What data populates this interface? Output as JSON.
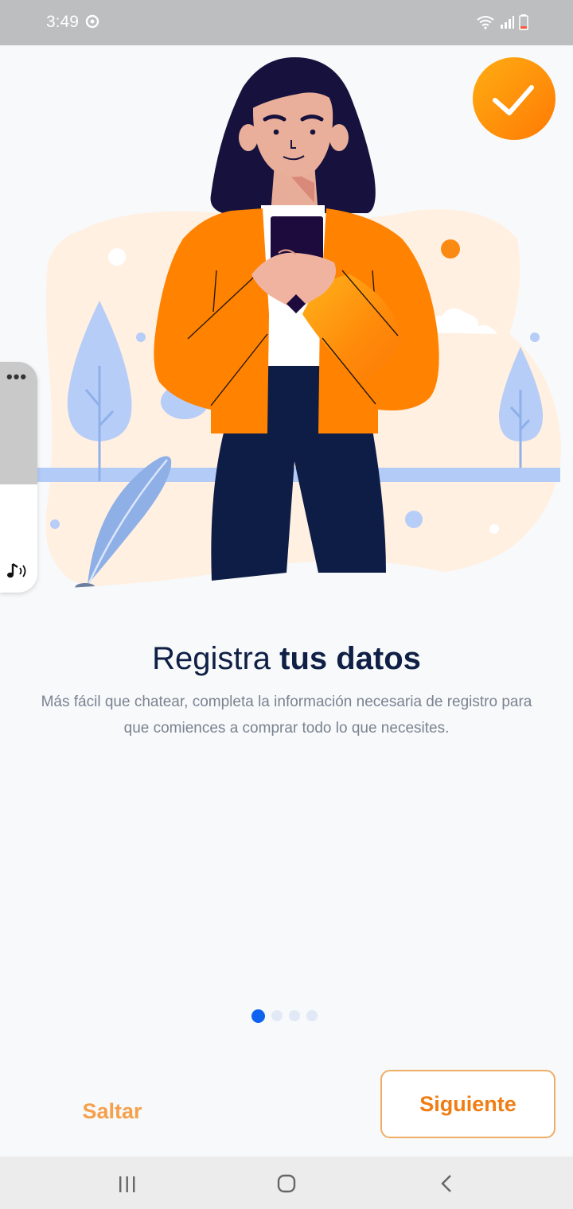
{
  "status_bar": {
    "time": "3:49"
  },
  "onboarding": {
    "title_regular": "Registra ",
    "title_bold": "tus datos",
    "description": "Más fácil que chatear,  completa la información necesaria de registro para que comiences a comprar todo lo que necesites.",
    "page_index": 1,
    "page_count": 4
  },
  "buttons": {
    "skip": "Saltar",
    "next": "Siguiente"
  },
  "colors": {
    "accent": "#f07d14",
    "dot_active": "#0d62f0",
    "title": "#0f1f45"
  }
}
